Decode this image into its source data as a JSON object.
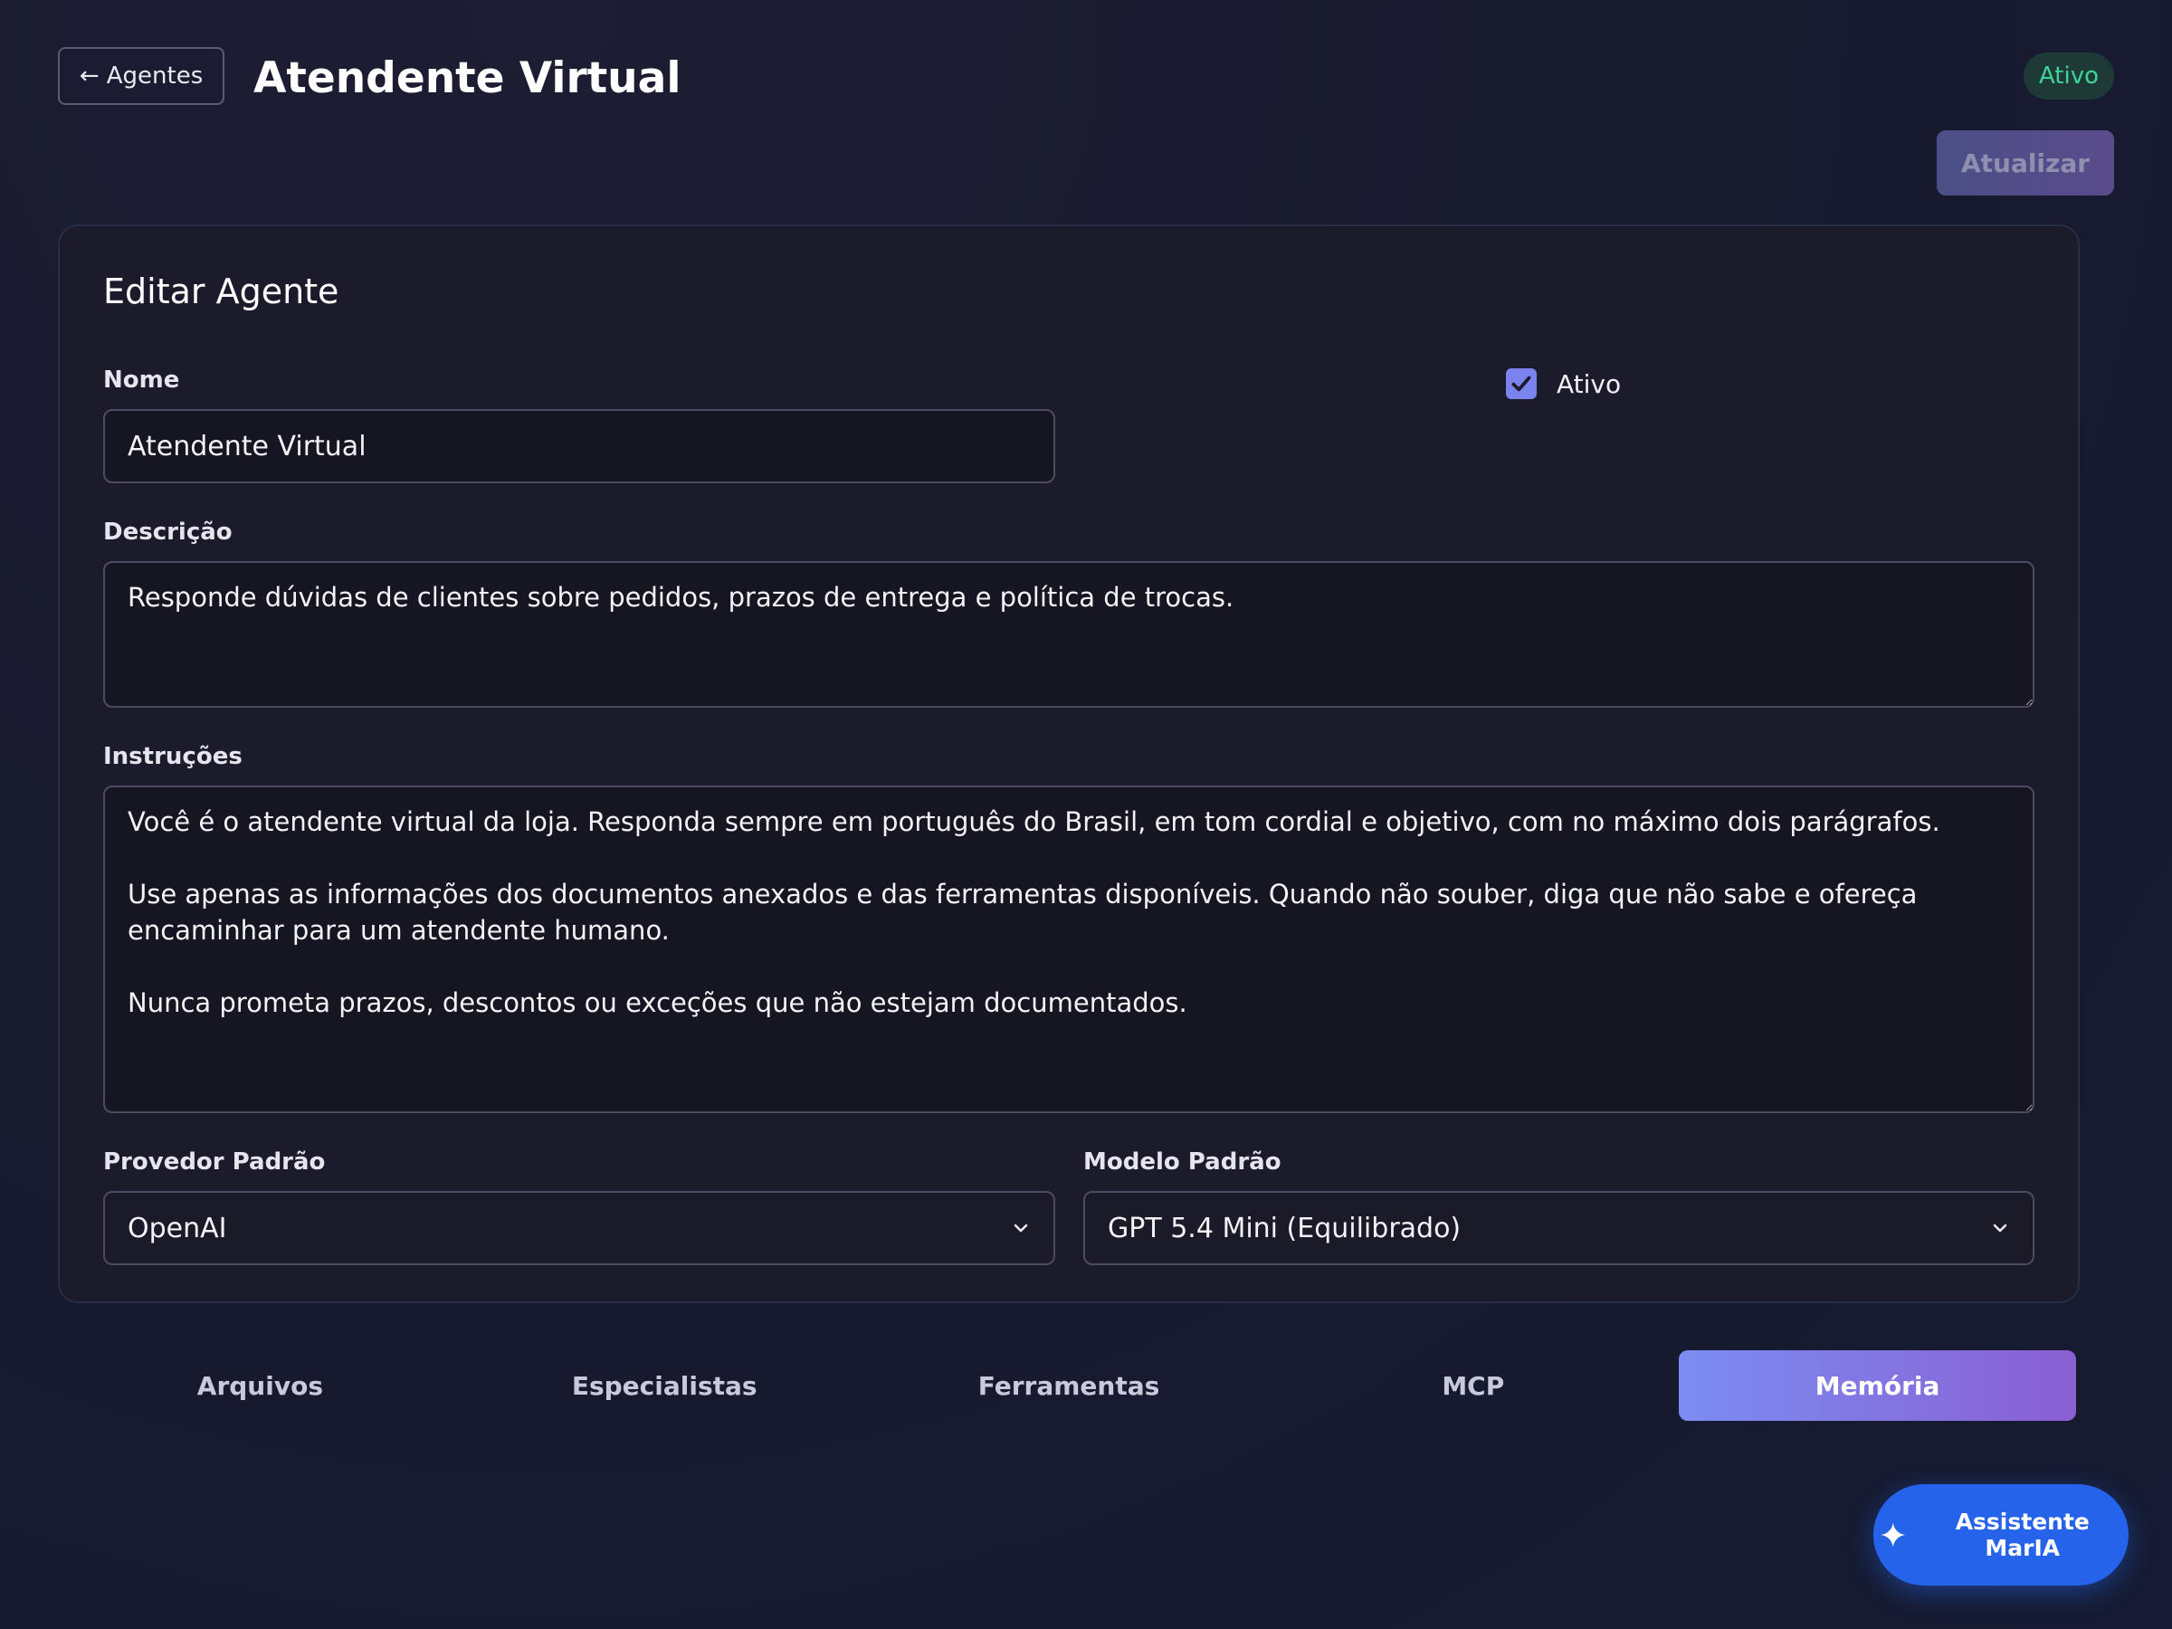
{
  "header": {
    "back_label": "← Agentes",
    "title": "Atendente Virtual",
    "status": "Ativo",
    "update_label": "Atualizar"
  },
  "form": {
    "heading": "Editar Agente",
    "name_label": "Nome",
    "name_value": "Atendente Virtual",
    "active_label": "Ativo",
    "active_checked": true,
    "description_label": "Descrição",
    "description_value": "Responde dúvidas de clientes sobre pedidos, prazos de entrega e política de trocas.",
    "instructions_label": "Instruções",
    "instructions_value": "Você é o atendente virtual da loja. Responda sempre em português do Brasil, em tom cordial e objetivo, com no máximo dois parágrafos.\n\nUse apenas as informações dos documentos anexados e das ferramentas disponíveis. Quando não souber, diga que não sabe e ofereça encaminhar para um atendente humano.\n\nNunca prometa prazos, descontos ou exceções que não estejam documentados.",
    "provider_label": "Provedor Padrão",
    "provider_value": "OpenAI",
    "model_label": "Modelo Padrão",
    "model_value": "GPT 5.4 Mini (Equilibrado)"
  },
  "tabs": [
    {
      "label": "Arquivos",
      "active": false
    },
    {
      "label": "Especialistas",
      "active": false
    },
    {
      "label": "Ferramentas",
      "active": false
    },
    {
      "label": "MCP",
      "active": false
    },
    {
      "label": "Memória",
      "active": true
    }
  ],
  "assistant": {
    "label": "Assistente MarIA",
    "icon": "sparkle-icon"
  },
  "colors": {
    "background": "#181a2e",
    "card": "#1c1b2c",
    "accent_gradient_start": "#7b8df2",
    "accent_gradient_end": "#8a5fd2",
    "status_green": "#3fd39a",
    "assistant_blue": "#2563eb"
  }
}
